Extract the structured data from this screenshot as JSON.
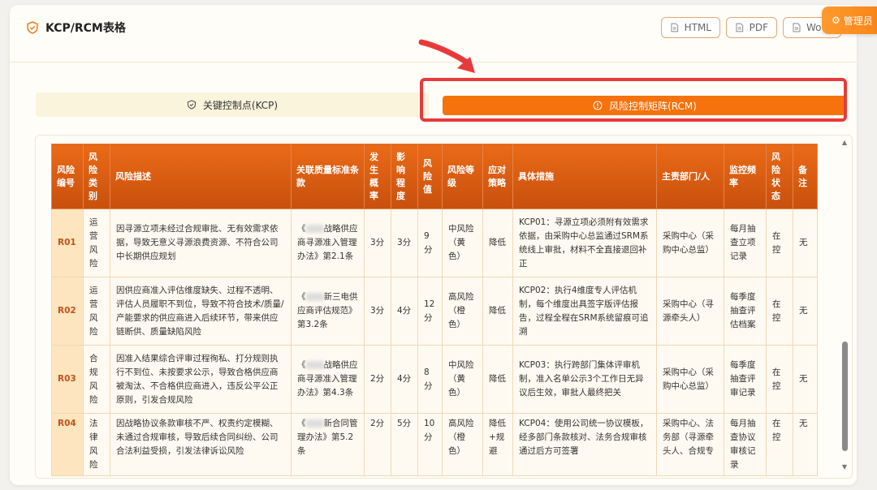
{
  "header": {
    "title": "KCP/RCM表格",
    "export_html": "HTML",
    "export_pdf": "PDF",
    "export_word": "Wo",
    "admin_label": "管理员"
  },
  "tabs": {
    "kcp": "关键控制点(KCP)",
    "rcm": "风险控制矩阵(RCM)"
  },
  "columns": [
    "风险编号",
    "风险类别",
    "风险描述",
    "关联质量标准条款",
    "发生概率",
    "影响程度",
    "风险值",
    "风险等级",
    "应对策略",
    "具体措施",
    "主责部门/人",
    "监控频率",
    "风险状态",
    "备注"
  ],
  "rows": [
    {
      "id": "R01",
      "category": "运营风险",
      "desc": "因寻源立项未经过合规审批、无有效需求依据，导致无意义寻源浪费资源、不符合公司中长期供应规划",
      "clause_pre": "《",
      "clause_post": "战略供应商寻源准入管理办法》第2.1条",
      "prob": "3分",
      "impact": "3分",
      "value": "9分",
      "level": "中风险（黄色）",
      "strategy": "降低",
      "measure": "KCP01：寻源立项必须附有效需求依据，由采购中心总监通过SRM系统线上审批，材料不全直接退回补正",
      "dept": "采购中心（采购中心总监）",
      "freq": "每月抽查立项记录",
      "status": "在控",
      "remark": "无"
    },
    {
      "id": "R02",
      "category": "运营风险",
      "desc": "因供应商准入评估维度缺失、过程不透明、评估人员履职不到位，导致不符合技术/质量/产能要求的供应商进入后续环节，带来供应链断供、质量缺陷风险",
      "clause_pre": "《",
      "clause_post": "新三电供应商评估规范》第3.2条",
      "prob": "3分",
      "impact": "4分",
      "value": "12分",
      "level": "高风险（橙色）",
      "strategy": "降低",
      "measure": "KCP02：执行4维度专人评估机制，每个维度出具签字版评估报告，过程全程在SRM系统留痕可追溯",
      "dept": "采购中心（寻源牵头人）",
      "freq": "每季度抽查评估档案",
      "status": "在控",
      "remark": "无"
    },
    {
      "id": "R03",
      "category": "合规风险",
      "desc": "因准入结果综合评审过程徇私、打分规则执行不到位、未按要求公示，导致合格供应商被淘汰、不合格供应商进入，违反公平公正原则，引发合规风险",
      "clause_pre": "《",
      "clause_post": "战略供应商寻源准入管理办法》第4.3条",
      "prob": "2分",
      "impact": "4分",
      "value": "8分",
      "level": "中风险（黄色）",
      "strategy": "降低",
      "measure": "KCP03：执行跨部门集体评审机制，准入名单公示3个工作日无异议后生效，审批人最终把关",
      "dept": "采购中心（采购中心总监）",
      "freq": "每季度抽查评审记录",
      "status": "在控",
      "remark": "无"
    },
    {
      "id": "R04",
      "category": "法律风险",
      "desc": "因战略协议条款审核不严、权责约定模糊、未通过合规审核，导致后续合同纠纷、公司合法利益受损，引发法律诉讼风险",
      "clause_pre": "《",
      "clause_post": "新合同管理办法》第5.2条",
      "prob": "2分",
      "impact": "5分",
      "value": "10分",
      "level": "高风险（橙色）",
      "strategy": "降低+规避",
      "measure": "KCP04：使用公司统一协议模板，经多部门条款核对、法务合规审核通过后方可签署",
      "dept": "采购中心、法务部（寻源牵头人、合规专",
      "freq": "每月抽查协议审核记录",
      "status": "在控",
      "remark": "无"
    }
  ],
  "colors": {
    "accent": "#f5720c",
    "header_bg": "#d9580f",
    "highlight": "#e83a3a"
  }
}
